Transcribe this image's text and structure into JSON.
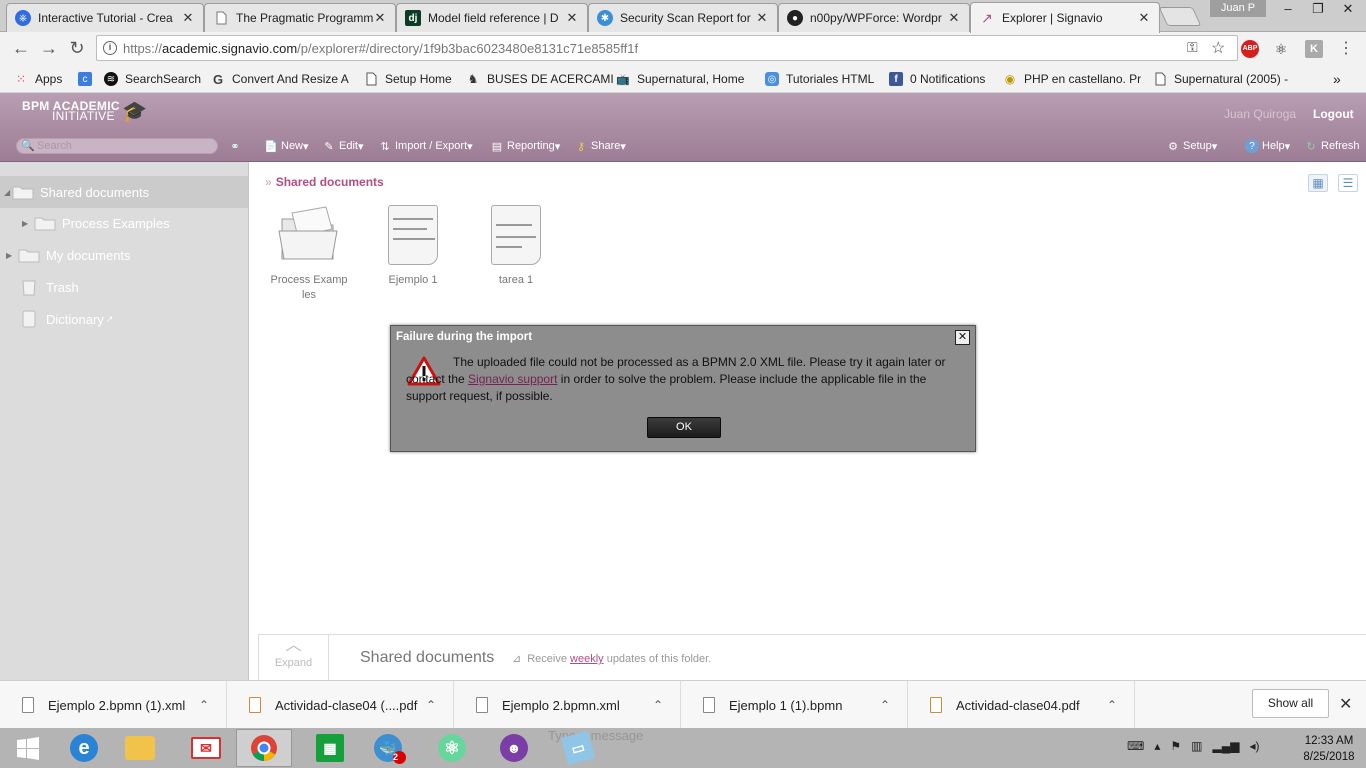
{
  "browser": {
    "tabs": [
      {
        "title": "Interactive Tutorial - Crea",
        "favicon": "k8s-icon",
        "color": "#326ce5"
      },
      {
        "title": "The Pragmatic Programm",
        "favicon": "page-icon",
        "color": "#777777"
      },
      {
        "title": "Model field reference | D",
        "favicon": "django-icon",
        "color": "#0c3c26"
      },
      {
        "title": "Security Scan Report for",
        "favicon": "shield-icon",
        "color": "#3a8fd6"
      },
      {
        "title": "n00py/WPForce: Wordpr",
        "favicon": "github-icon",
        "color": "#222222"
      },
      {
        "title": "Explorer | Signavio",
        "favicon": "signavio-icon",
        "color": "#b14e84"
      }
    ],
    "tab_close": "✕",
    "user_chip": "Juan P",
    "window_controls": {
      "minimize": "–",
      "restore": "❐",
      "close": "✕"
    },
    "url": {
      "scheme": "https://",
      "host": "academic.signavio.com",
      "path": "/p/explorer#/directory/1f9b3bac6023480e8131c71e8585ff1f"
    },
    "extensions": [
      "key-icon",
      "star-icon",
      "adblock-icon",
      "react-icon",
      "k-icon",
      "menu-icon"
    ],
    "extension_labels": {
      "adblock": "ABP",
      "k": "K"
    },
    "bookmarks": [
      {
        "label": "Apps",
        "icon": "apps-icon"
      },
      {
        "label": "SearchSearch",
        "icon": "spotify-icon"
      },
      {
        "label": "Convert And Resize A",
        "icon": "google-icon"
      },
      {
        "label": "Setup Home",
        "icon": "page-icon"
      },
      {
        "label": "BUSES DE ACERCAMI",
        "icon": "dog-icon"
      },
      {
        "label": "Supernatural, Home",
        "icon": "tv-icon"
      },
      {
        "label": "Tutoriales HTML",
        "icon": "globe-icon"
      },
      {
        "label": "0 Notifications",
        "icon": "facebook-icon"
      },
      {
        "label": "PHP en castellano. Pr",
        "icon": "php-icon"
      },
      {
        "label": "Supernatural (2005) -",
        "icon": "page-icon"
      }
    ],
    "bookmarks_more": "»"
  },
  "signavio": {
    "logo": {
      "line1": "BPM ACADEMIC",
      "line2": "INITIATIVE"
    },
    "user_name": "Juan Quiroga",
    "logout": "Logout",
    "search_placeholder": "Search",
    "toolbar": {
      "new": "New",
      "edit": "Edit",
      "import_export": "Import / Export",
      "reporting": "Reporting",
      "share": "Share",
      "setup": "Setup",
      "help": "Help",
      "refresh": "Refresh"
    },
    "tree": {
      "shared_documents": "Shared documents",
      "process_examples": "Process Examples",
      "my_documents": "My documents",
      "trash": "Trash",
      "dictionary": "Dictionary"
    },
    "breadcrumb": {
      "separator": "»",
      "current": "Shared documents"
    },
    "items": [
      {
        "label": "Process Examp les",
        "kind": "folder"
      },
      {
        "label": "Ejemplo 1",
        "kind": "diagram"
      },
      {
        "label": "tarea 1",
        "kind": "diagram"
      }
    ],
    "dialog": {
      "title": "Failure during the import",
      "message_before_link": "The uploaded file could not be processed as a BPMN 2.0 XML file. Please try it again later or contact the ",
      "link": "Signavio support",
      "message_after_link": " in order to solve the problem. Please include the applicable file in the support request, if possible.",
      "ok": "OK",
      "close": "✕"
    },
    "folder_bar": {
      "expand": "Expand",
      "title": "Shared documents",
      "receive": "Receive ",
      "weekly": "weekly",
      "updates": " updates of this folder."
    }
  },
  "downloads": {
    "items": [
      {
        "name": "Ejemplo 2.bpmn (1).xml",
        "type": "xml"
      },
      {
        "name": "Actividad-clase04 (....pdf",
        "type": "pdf"
      },
      {
        "name": "Ejemplo 2.bpmn.xml",
        "type": "xml"
      },
      {
        "name": "Ejemplo 1 (1).bpmn",
        "type": "bpmn"
      },
      {
        "name": "Actividad-clase04.pdf",
        "type": "pdf"
      }
    ],
    "chevron": "⌃",
    "show_all": "Show all",
    "close": "✕"
  },
  "taskbar": {
    "apps": [
      "windows-start-icon",
      "internet-explorer-icon",
      "file-explorer-icon",
      "mail-icon",
      "chrome-icon",
      "store-icon",
      "docker-icon",
      "atom-icon",
      "github-desktop-icon",
      "notes-icon"
    ],
    "ghost_text": "Type a message",
    "clock_time": "12:33 AM",
    "clock_date": "8/25/2018",
    "badge": "2"
  },
  "colors": {
    "signavio_header": "#a88aa1",
    "signavio_accent": "#b14e84",
    "dialog_bg": "#8d8d8d",
    "warning_red": "#cc1111"
  }
}
